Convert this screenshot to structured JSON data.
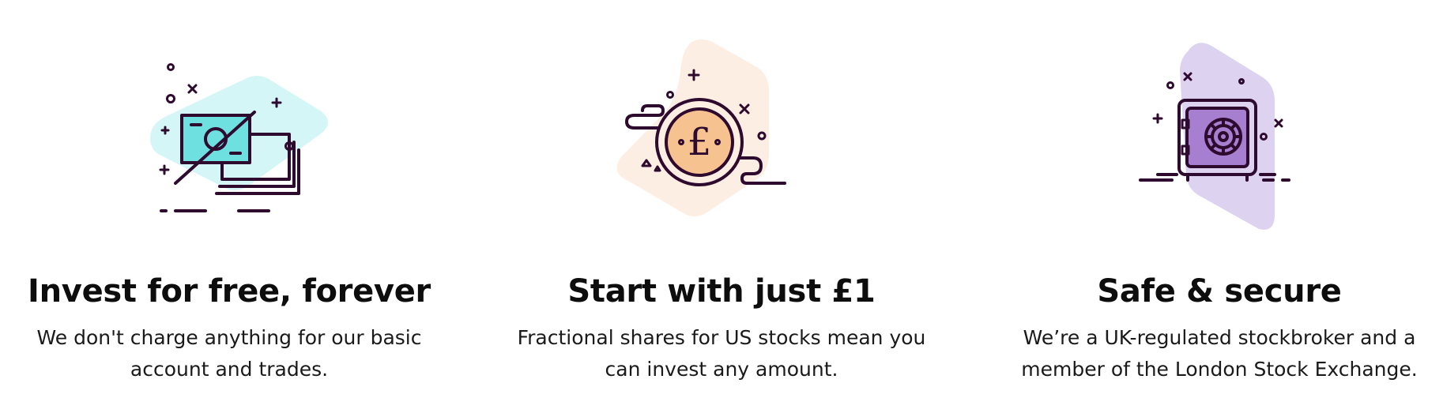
{
  "features": [
    {
      "title": "Invest for free, forever",
      "description": "We don't charge anything for our basic account and trades.",
      "icon": "no-fee-banknote-icon",
      "blob_color": "#d4f6f6",
      "accent_color": "#6fe0e0"
    },
    {
      "title": "Start with just £1",
      "description": "Fractional shares for US stocks mean you can invest any amount.",
      "icon": "pound-coin-icon",
      "coin_symbol": "£",
      "blob_color": "#fdeee3",
      "accent_color": "#f6c28f"
    },
    {
      "title": "Safe & secure",
      "description": "We’re a UK-regulated stockbroker and a member of the London Stock Exchange.",
      "icon": "safe-vault-icon",
      "blob_color": "#ddd3f0",
      "accent_color": "#a77fd1"
    }
  ],
  "line_color": "#2d0a2e"
}
